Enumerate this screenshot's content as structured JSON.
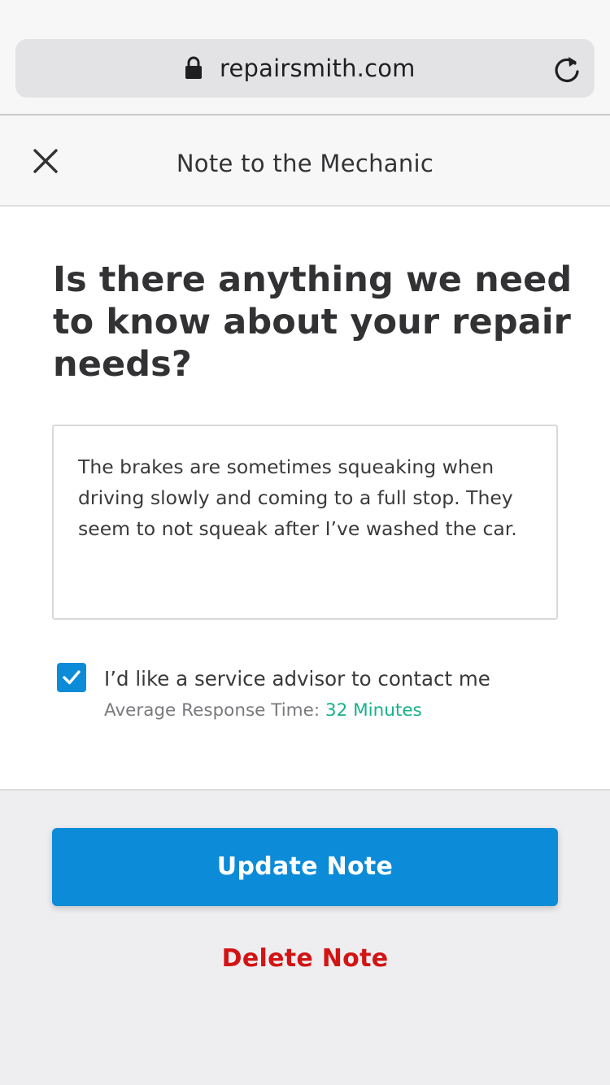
{
  "browser": {
    "url": "repairsmith.com",
    "lock_icon": "lock-icon",
    "reload_icon": "reload-icon"
  },
  "header": {
    "title": "Note to the Mechanic",
    "close_icon": "close-icon"
  },
  "main": {
    "question": "Is there anything we need to know about your repair needs?",
    "note_text": "The brakes are sometimes squeaking when driving slowly and coming to a full stop. They seem to not squeak after I’ve washed the car.",
    "contact_checkbox": {
      "checked": true,
      "label": "I’d like a service advisor to contact me",
      "response_label": "Average Response Time:",
      "response_value": "32 Minutes"
    }
  },
  "footer": {
    "update_label": "Update Note",
    "delete_label": "Delete Note"
  },
  "colors": {
    "primary": "#0b8bd8",
    "danger": "#d21414",
    "accent_green": "#17b08c"
  }
}
